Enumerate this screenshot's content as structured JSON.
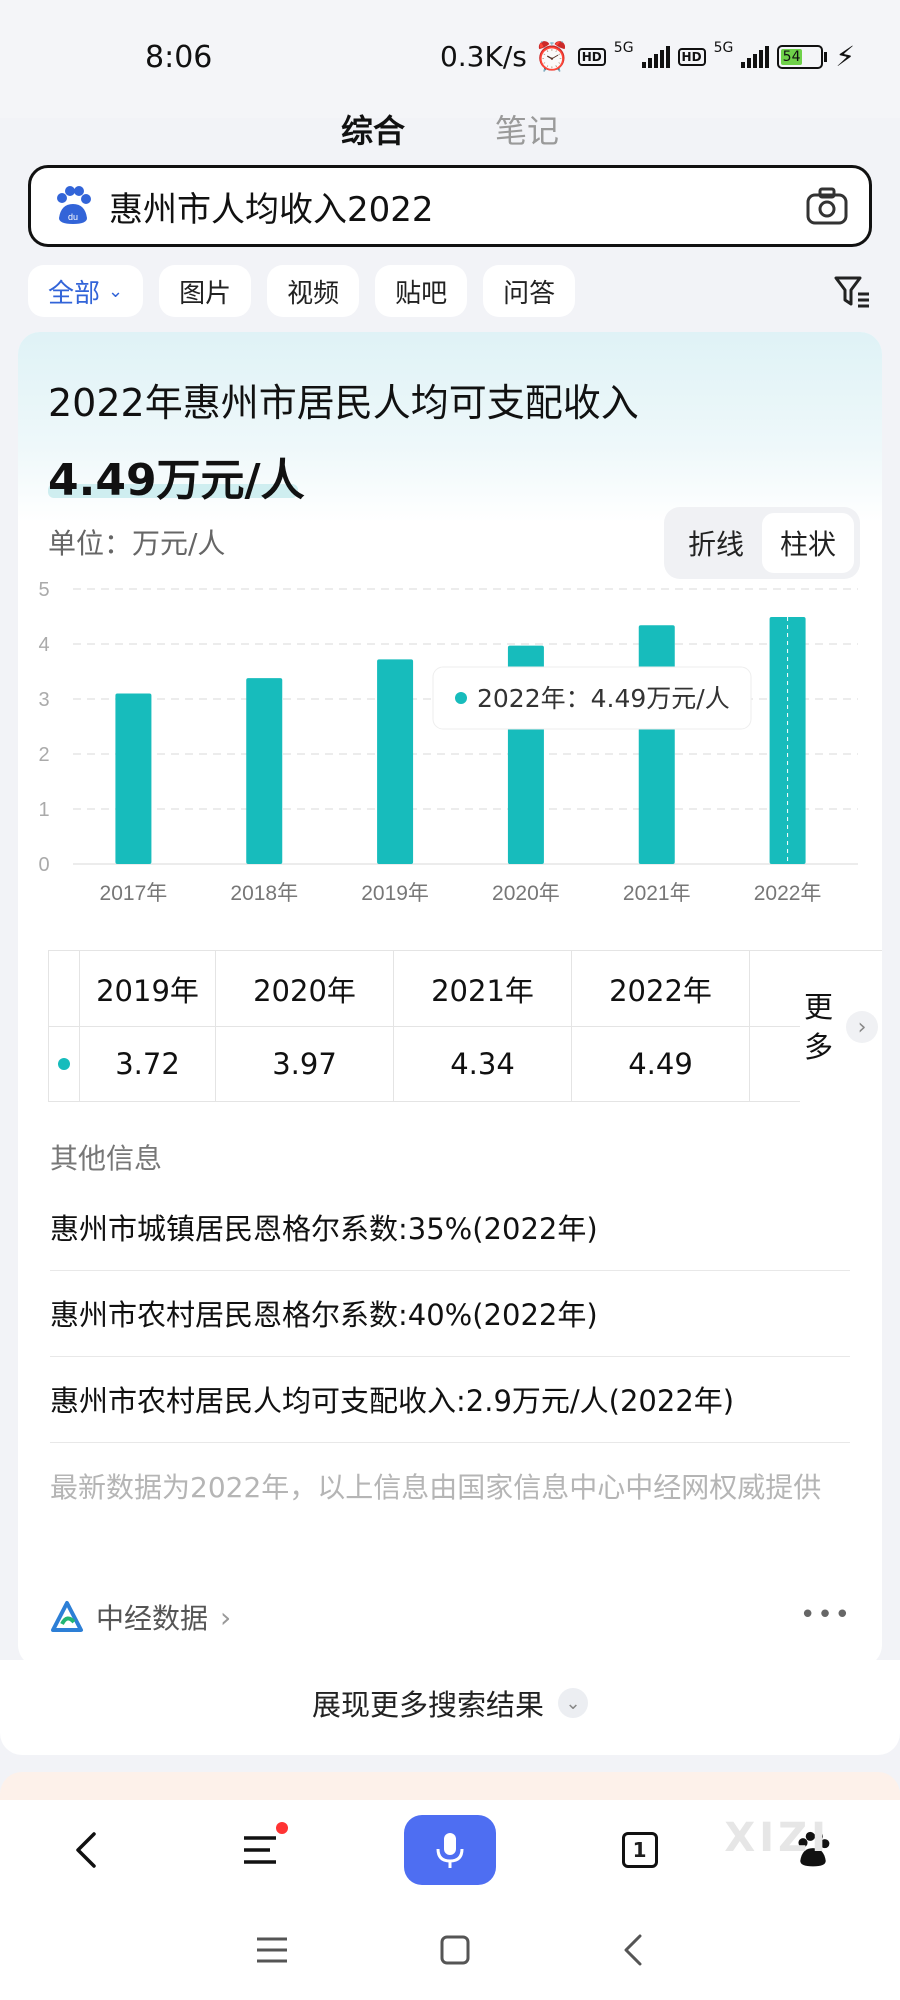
{
  "status_bar": {
    "time": "8:06",
    "net_speed": "0.3K/s",
    "network1": "5G",
    "network2": "5G",
    "battery": "54"
  },
  "tabs": [
    "综合",
    "笔记"
  ],
  "search": {
    "query": "惠州市人均收入2022"
  },
  "filters": [
    "全部",
    "图片",
    "视频",
    "贴吧",
    "问答"
  ],
  "card": {
    "title": "2022年惠州市居民人均可支配收入",
    "value": "4.49万元/人",
    "unit_label": "单位：万元/人",
    "toggle": [
      "折线",
      "柱状"
    ],
    "tooltip": "2022年：4.49万元/人",
    "table": {
      "years": [
        "2019年",
        "2020年",
        "2021年",
        "2022年"
      ],
      "values": [
        "3.72",
        "3.97",
        "4.34",
        "4.49"
      ],
      "more_label": "更多"
    },
    "other_title": "其他信息",
    "info": [
      "惠州市城镇居民恩格尔系数:35%(2022年)",
      "惠州市农村居民恩格尔系数:40%(2022年)",
      "惠州市农村居民人均可支配收入:2.9万元/人(2022年)"
    ],
    "footnote": "最新数据为2022年，以上信息由国家信息中心中经网权威提供",
    "source": "中经数据"
  },
  "show_more": "展现更多搜索结果",
  "bottom_nav": {
    "tab_count": "1"
  },
  "watermark": "XIZI",
  "colors": {
    "bar": "#17bcbc",
    "accent": "#4e6ef2",
    "chip_active": "#3264d8"
  },
  "chart_data": {
    "type": "bar",
    "categories": [
      "2017年",
      "2018年",
      "2019年",
      "2020年",
      "2021年",
      "2022年"
    ],
    "values": [
      3.1,
      3.38,
      3.72,
      3.97,
      4.34,
      4.49
    ],
    "ylim": [
      0,
      5
    ],
    "yticks": [
      0,
      1,
      2,
      3,
      4,
      5
    ],
    "grid": true,
    "title": "",
    "xlabel": "",
    "ylabel": ""
  }
}
